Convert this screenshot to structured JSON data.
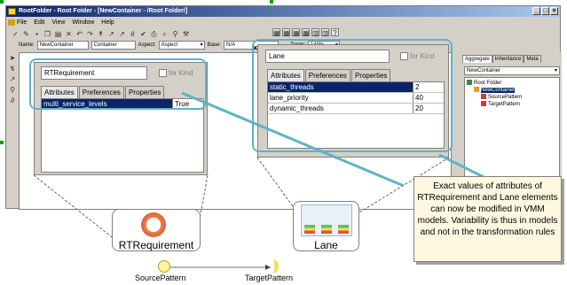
{
  "window": {
    "title": "RootFolder - Root Folder - [NewContainer - /Root Folder/]",
    "menu": [
      "File",
      "Edit",
      "View",
      "Window",
      "Help"
    ]
  },
  "propbar": {
    "name_label": "Name:",
    "name_value": "NewContainer",
    "kind_value": "Container",
    "aspect_label": "Aspect:",
    "aspect_value": "Aspect",
    "base_label": "Base:",
    "base_value": "N/A",
    "zoom_label": "Zoom:",
    "zoom_value": "140%"
  },
  "right_panel": {
    "tabs": [
      "Aggregate",
      "Inheritance",
      "Meta"
    ],
    "selector": "NewContainer",
    "tree": [
      {
        "label": "Root Folder",
        "depth": 0
      },
      {
        "label": "NewContainer",
        "depth": 1
      },
      {
        "label": "SourcePattern",
        "depth": 2
      },
      {
        "label": "TargetPattern",
        "depth": 2
      }
    ]
  },
  "left_panel": {
    "name": "RTRequirement",
    "for_kind": "for Kind",
    "tabs": [
      "Attributes",
      "Preferences",
      "Properties"
    ],
    "rows": [
      {
        "name": "multi_service_levels",
        "value": "True"
      }
    ]
  },
  "right_model_panel": {
    "name": "Lane",
    "for_kind": "for Kind",
    "tabs": [
      "Attributes",
      "Preferences",
      "Properties"
    ],
    "rows": [
      {
        "name": "static_threads",
        "value": "2"
      },
      {
        "name": "lane_priority",
        "value": "40"
      },
      {
        "name": "dynamic_threads",
        "value": "20"
      }
    ]
  },
  "labels": {
    "rtreq": "RTRequirement",
    "lane": "Lane",
    "source": "SourcePattern",
    "target": "TargetPattern"
  },
  "callout": "Exact values of attributes of RTRequirement and Lane elements can now be modified in VMM models. Variability is thus in models and not in the transformation rules"
}
